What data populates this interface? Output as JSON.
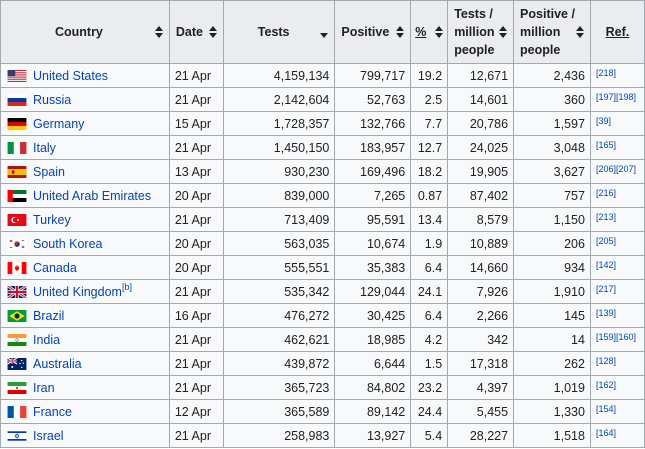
{
  "headers": {
    "country": "Country",
    "date": "Date",
    "tests": "Tests",
    "positive": "Positive",
    "percent": "%",
    "tests_per_million": [
      "Tests /",
      "million",
      "people"
    ],
    "positive_per_million": [
      "Positive /",
      "million",
      "people"
    ],
    "ref": "Ref."
  },
  "rows": [
    {
      "country": "United States",
      "flag": "us",
      "date": "21 Apr",
      "tests": "4,159,134",
      "positive": "799,717",
      "pct": "19.2",
      "tpm": "12,671",
      "ppm": "2,436",
      "ref": "[218]",
      "sup": ""
    },
    {
      "country": "Russia",
      "flag": "ru",
      "date": "21 Apr",
      "tests": "2,142,604",
      "positive": "52,763",
      "pct": "2.5",
      "tpm": "14,601",
      "ppm": "360",
      "ref": "[197][198]",
      "sup": ""
    },
    {
      "country": "Germany",
      "flag": "de",
      "date": "15 Apr",
      "tests": "1,728,357",
      "positive": "132,766",
      "pct": "7.7",
      "tpm": "20,786",
      "ppm": "1,597",
      "ref": "[39]",
      "sup": ""
    },
    {
      "country": "Italy",
      "flag": "it",
      "date": "21 Apr",
      "tests": "1,450,150",
      "positive": "183,957",
      "pct": "12.7",
      "tpm": "24,025",
      "ppm": "3,048",
      "ref": "[165]",
      "sup": ""
    },
    {
      "country": "Spain",
      "flag": "es",
      "date": "13 Apr",
      "tests": "930,230",
      "positive": "169,496",
      "pct": "18.2",
      "tpm": "19,905",
      "ppm": "3,627",
      "ref": "[206][207]",
      "sup": ""
    },
    {
      "country": "United Arab Emirates",
      "flag": "ae",
      "date": "20 Apr",
      "tests": "839,000",
      "positive": "7,265",
      "pct": "0.87",
      "tpm": "87,402",
      "ppm": "757",
      "ref": "[216]",
      "sup": ""
    },
    {
      "country": "Turkey",
      "flag": "tr",
      "date": "21 Apr",
      "tests": "713,409",
      "positive": "95,591",
      "pct": "13.4",
      "tpm": "8,579",
      "ppm": "1,150",
      "ref": "[213]",
      "sup": ""
    },
    {
      "country": "South Korea",
      "flag": "kr",
      "date": "20 Apr",
      "tests": "563,035",
      "positive": "10,674",
      "pct": "1.9",
      "tpm": "10,889",
      "ppm": "206",
      "ref": "[205]",
      "sup": ""
    },
    {
      "country": "Canada",
      "flag": "ca",
      "date": "20 Apr",
      "tests": "555,551",
      "positive": "35,383",
      "pct": "6.4",
      "tpm": "14,660",
      "ppm": "934",
      "ref": "[142]",
      "sup": ""
    },
    {
      "country": "United Kingdom",
      "flag": "gb",
      "date": "21 Apr",
      "tests": "535,342",
      "positive": "129,044",
      "pct": "24.1",
      "tpm": "7,926",
      "ppm": "1,910",
      "ref": "[217]",
      "sup": "[b]"
    },
    {
      "country": "Brazil",
      "flag": "br",
      "date": "16 Apr",
      "tests": "476,272",
      "positive": "30,425",
      "pct": "6.4",
      "tpm": "2,266",
      "ppm": "145",
      "ref": "[139]",
      "sup": ""
    },
    {
      "country": "India",
      "flag": "in",
      "date": "21 Apr",
      "tests": "462,621",
      "positive": "18,985",
      "pct": "4.2",
      "tpm": "342",
      "ppm": "14",
      "ref": "[159][160]",
      "sup": ""
    },
    {
      "country": "Australia",
      "flag": "au",
      "date": "21 Apr",
      "tests": "439,872",
      "positive": "6,644",
      "pct": "1.5",
      "tpm": "17,318",
      "ppm": "262",
      "ref": "[128]",
      "sup": ""
    },
    {
      "country": "Iran",
      "flag": "ir",
      "date": "21 Apr",
      "tests": "365,723",
      "positive": "84,802",
      "pct": "23.2",
      "tpm": "4,397",
      "ppm": "1,019",
      "ref": "[162]",
      "sup": ""
    },
    {
      "country": "France",
      "flag": "fr",
      "date": "12 Apr",
      "tests": "365,589",
      "positive": "89,142",
      "pct": "24.4",
      "tpm": "5,455",
      "ppm": "1,330",
      "ref": "[154]",
      "sup": ""
    },
    {
      "country": "Israel",
      "flag": "il",
      "date": "21 Apr",
      "tests": "258,983",
      "positive": "13,927",
      "pct": "5.4",
      "tpm": "28,227",
      "ppm": "1,518",
      "ref": "[164]",
      "sup": ""
    }
  ],
  "colors": {
    "link": "#0645ad",
    "header_bg": "#eaecf0",
    "cell_bg": "#f8f9fa",
    "border": "#a2a9b1"
  }
}
